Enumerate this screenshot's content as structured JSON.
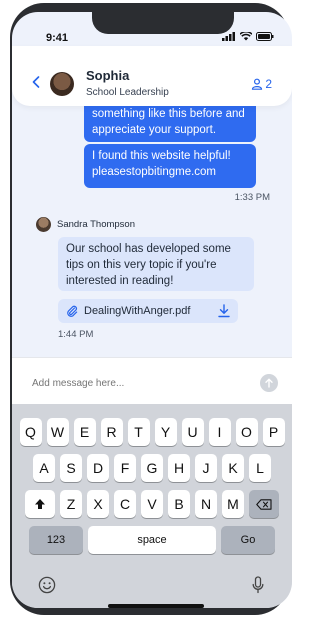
{
  "status": {
    "time": "9:41"
  },
  "header": {
    "name": "Sophia",
    "role": "School Leadership",
    "member_count": "2"
  },
  "messages": [
    {
      "type": "out",
      "text": "something like this before and appreciate your support."
    },
    {
      "type": "out",
      "text": "I found this website helpful! pleasestopbitingme.com"
    }
  ],
  "timestamps": {
    "first": "1:33 PM",
    "second": "1:44 PM"
  },
  "incoming": {
    "sender": "Sandra Thompson",
    "text": "Our school has developed some tips on this very topic if you're interested in reading!",
    "attachment": "DealingWithAnger.pdf"
  },
  "composer": {
    "placeholder": "Add message here..."
  },
  "keyboard": {
    "row1": [
      "Q",
      "W",
      "E",
      "R",
      "T",
      "Y",
      "U",
      "I",
      "O",
      "P"
    ],
    "row2": [
      "A",
      "S",
      "D",
      "F",
      "G",
      "H",
      "J",
      "K",
      "L"
    ],
    "row3": [
      "Z",
      "X",
      "C",
      "V",
      "B",
      "N",
      "M"
    ],
    "k123": "123",
    "space": "space",
    "go": "Go"
  }
}
